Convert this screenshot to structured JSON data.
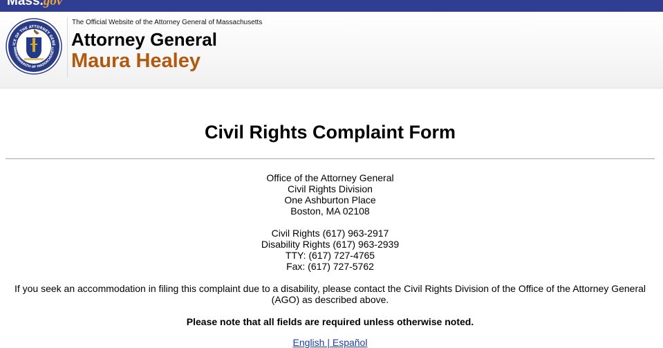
{
  "topbar": {
    "logo_main": "Mass",
    "logo_dot": ".",
    "logo_go": "gov"
  },
  "header": {
    "tagline": "The Official Website of the Attorney General of Massachusetts",
    "org_title": "Attorney General",
    "person_name": "Maura Healey",
    "seal": {
      "outer_text": "OFFICE OF THE ATTORNEY GENERAL",
      "bottom_text": "COMMONWEALTH OF MASSACHUSETTS",
      "colors": {
        "ring": "#2a3b86",
        "shield": "#1f3a8a",
        "figure": "#d8a62a"
      }
    }
  },
  "form": {
    "title": "Civil Rights Complaint Form",
    "address_lines": [
      "Office of the Attorney General",
      "Civil Rights Division",
      "One Ashburton Place",
      "Boston, MA 02108"
    ],
    "phone_lines": [
      "Civil Rights (617) 963-2917",
      "Disability Rights (617) 963-2939",
      "TTY: (617) 727-4765",
      "Fax: (617) 727-5762"
    ],
    "accommodation_text": "If you seek an accommodation in filing this complaint due to a disability, please contact the Civil Rights Division of the Office of the Attorney General (AGO) as described above.",
    "required_note": "Please note that all fields are required unless otherwise noted.",
    "language_links": "English | Español"
  },
  "colors": {
    "topbar": "#2f3d93",
    "name_accent": "#b05a10",
    "link": "#1a3fa0"
  }
}
